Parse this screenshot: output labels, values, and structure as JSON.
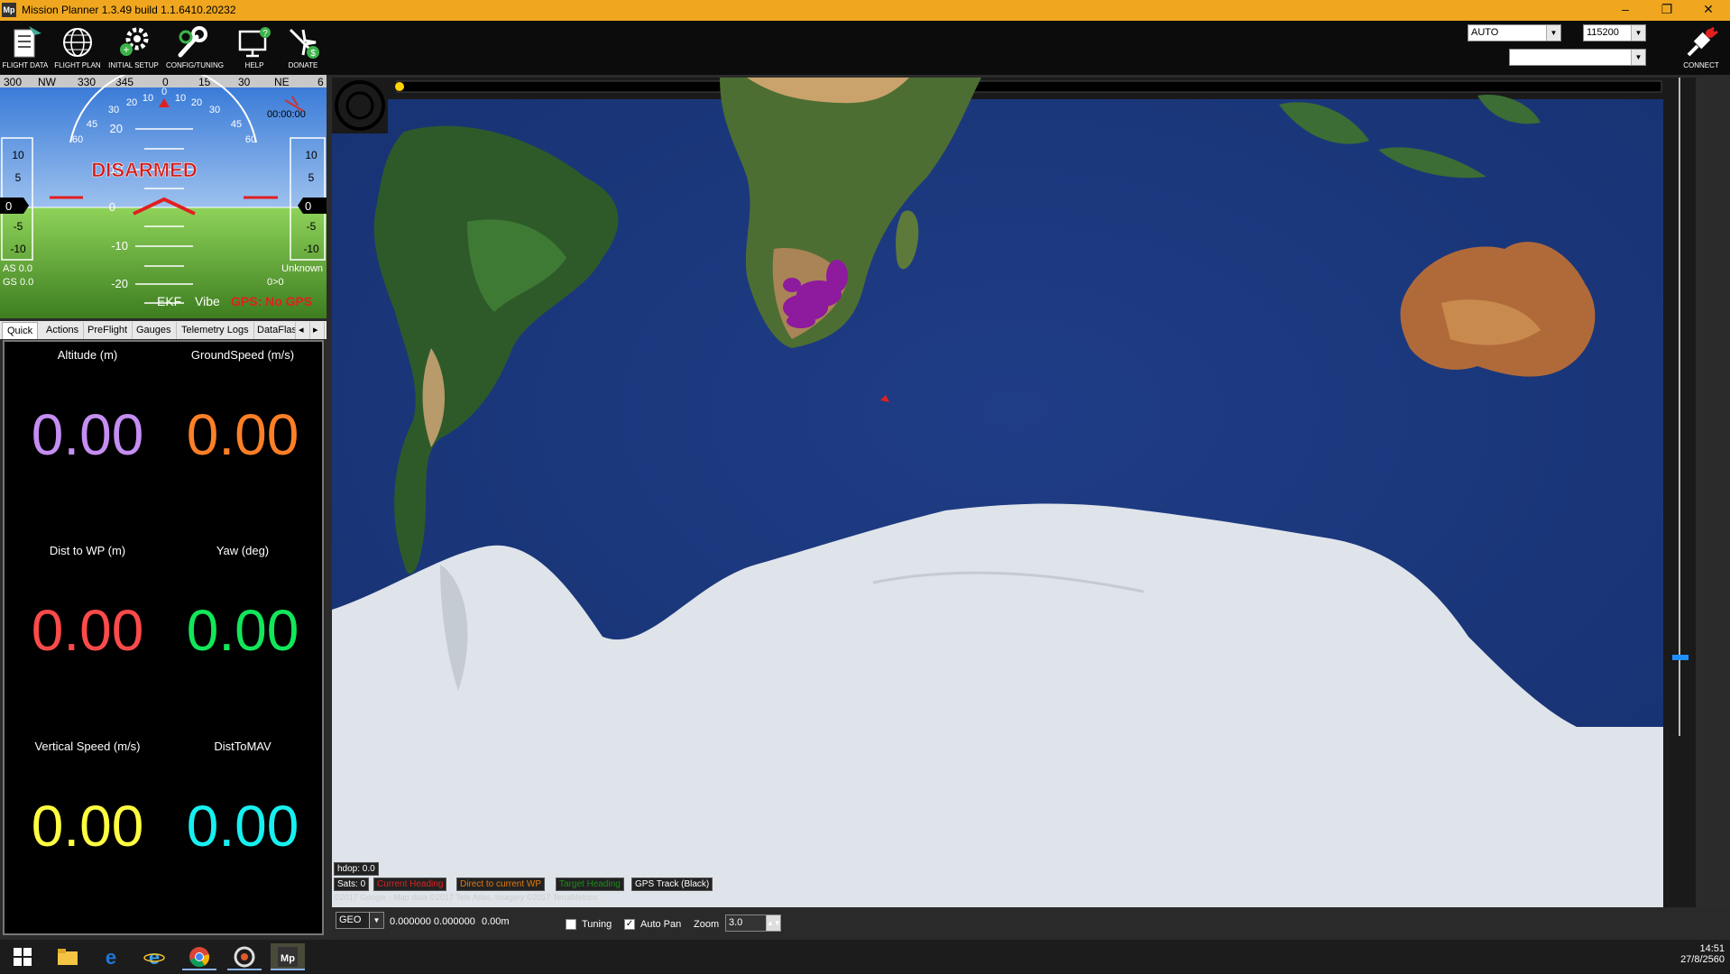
{
  "window": {
    "title": "Mission Planner 1.3.49 build 1.1.6410.20232",
    "app_icon_text": "Mp",
    "minimize": "–",
    "restore": "❐",
    "close": "✕"
  },
  "toolbar": {
    "buttons": [
      {
        "label": "FLIGHT DATA",
        "icon": "flight-data-icon"
      },
      {
        "label": "FLIGHT PLAN",
        "icon": "globe-icon"
      },
      {
        "label": "INITIAL SETUP",
        "icon": "gears-icon"
      },
      {
        "label": "CONFIG/TUNING",
        "icon": "wrench-icon"
      },
      {
        "label": "HELP",
        "icon": "monitor-help-icon"
      },
      {
        "label": "DONATE",
        "icon": "donate-plane-icon"
      }
    ],
    "connect_label": "CONNECT",
    "port_value": "AUTO",
    "baud_value": "115200",
    "profile_value": ""
  },
  "hud": {
    "compass_labels": [
      "300",
      "NW",
      "330",
      "345",
      "0",
      "15",
      "30",
      "NE",
      "6"
    ],
    "status": "DISARMED",
    "pitch_labels": [
      "20",
      "10",
      "0",
      "-10",
      "-20"
    ],
    "roll_labels": [
      "60",
      "45",
      "30",
      "20",
      "10",
      "0",
      "10",
      "20",
      "30",
      "45",
      "60"
    ],
    "left_tape": [
      "10",
      "5",
      "0",
      "-5",
      "-10"
    ],
    "right_tape": [
      "10",
      "5",
      "0",
      "-5",
      "-10"
    ],
    "speed_value": "0",
    "alt_value": "0",
    "time": "00:00:00",
    "airspeed": "AS 0.0",
    "groundspeed": "GS 0.0",
    "mode": "Unknown",
    "wp": "0>0",
    "ekf": "EKF",
    "vibe": "Vibe",
    "gps": "GPS: No GPS"
  },
  "tabs": [
    "Quick",
    "Actions",
    "PreFlight",
    "Gauges",
    "Telemetry Logs",
    "DataFlas"
  ],
  "quick": [
    {
      "label": "Altitude (m)",
      "value": "0.00",
      "color": "#c48ef2"
    },
    {
      "label": "GroundSpeed (m/s)",
      "value": "0.00",
      "color": "#ff7f27"
    },
    {
      "label": "Dist to WP (m)",
      "value": "0.00",
      "color": "#ff4a4a"
    },
    {
      "label": "Yaw (deg)",
      "value": "0.00",
      "color": "#12e65a"
    },
    {
      "label": "Vertical Speed (m/s)",
      "value": "0.00",
      "color": "#ffff40"
    },
    {
      "label": "DistToMAV",
      "value": "0.00",
      "color": "#18f0f0"
    }
  ],
  "map": {
    "hdop": "hdop: 0.0",
    "sats": "Sats: 0",
    "legend": [
      {
        "label": "Current Heading",
        "color": "#e02020"
      },
      {
        "label": "Direct to current WP",
        "color": "#e07a10"
      },
      {
        "label": "Target Heading",
        "color": "#1c8a1c"
      },
      {
        "label": "GPS Track (Black)",
        "color": "#ffffff"
      }
    ],
    "copyright": "©2017 Google - Map data ©2017 Tele Atlas, Imagery ©2017 TerraMetrics",
    "zero_marker": "0"
  },
  "statusbar": {
    "coord_system": "GEO",
    "coords": "0.000000 0.000000",
    "alt": "0.00m",
    "tuning_label": "Tuning",
    "tuning_checked": false,
    "autopan_label": "Auto Pan",
    "autopan_checked": true,
    "zoom_label": "Zoom",
    "zoom_value": "3.0"
  },
  "taskbar": {
    "time": "14:51",
    "date": "27/8/2560",
    "apps": [
      "start-icon",
      "file-explorer-icon",
      "edge-icon",
      "ie-icon",
      "chrome-icon",
      "app-icon",
      "mission-planner-icon"
    ]
  }
}
